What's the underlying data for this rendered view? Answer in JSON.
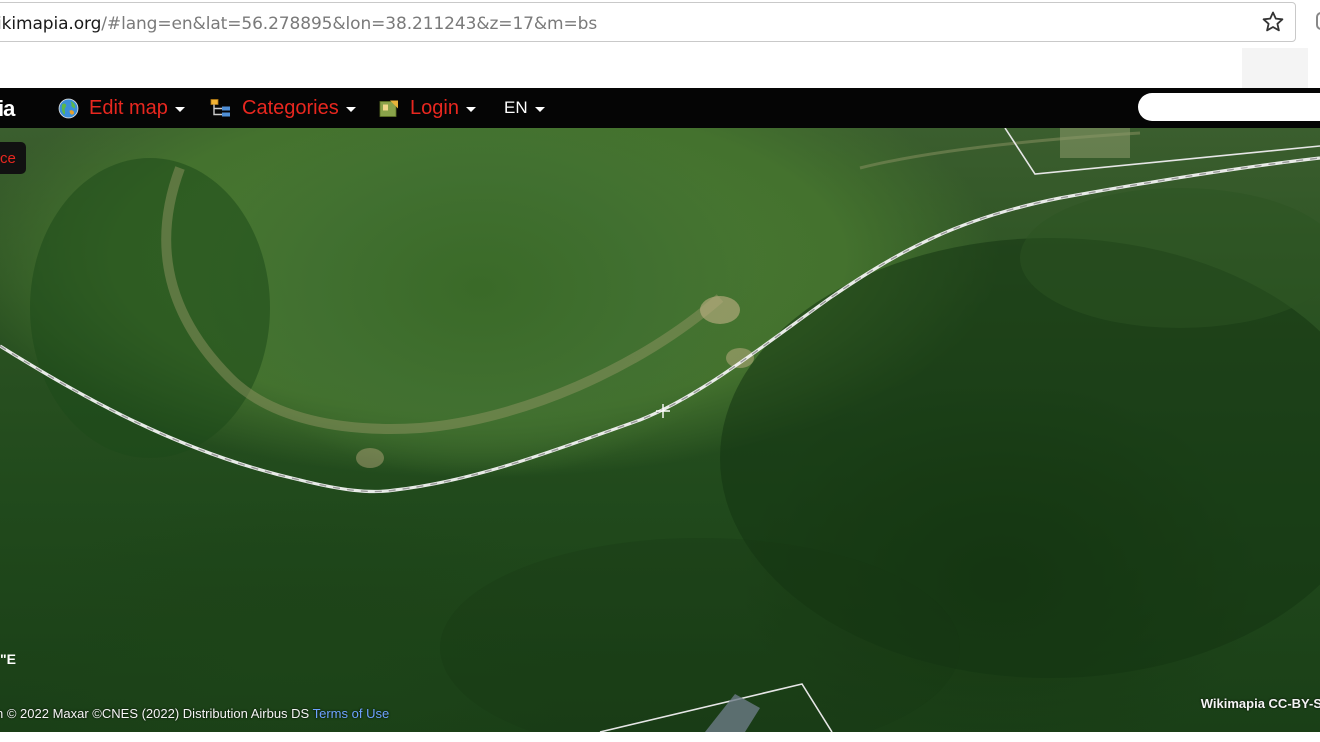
{
  "browser": {
    "url_host": "ikimapia.org",
    "url_rest": "/#lang=en&lat=56.278895&lon=38.211243&z=17&m=bs"
  },
  "nav": {
    "logo": "ia",
    "edit_map": "Edit map",
    "categories": "Categories",
    "login": "Login",
    "language": "EN",
    "search_placeholder": ""
  },
  "map": {
    "place_badge": "ce",
    "coordinate_fragment": "\"E",
    "attribution_text": "n © 2022 Maxar ©CNES (2022) Distribution Airbus DS ",
    "terms_link": "Terms of Use",
    "license": "Wikimapia CC-BY-S"
  },
  "colors": {
    "nav_background": "#050505",
    "nav_link": "#e8271f",
    "terms_link": "#6ea3ff"
  },
  "icons": {
    "edit_map": "globe-icon",
    "categories": "tree-list-icon",
    "login": "key-card-icon",
    "bookmark": "star-icon"
  }
}
